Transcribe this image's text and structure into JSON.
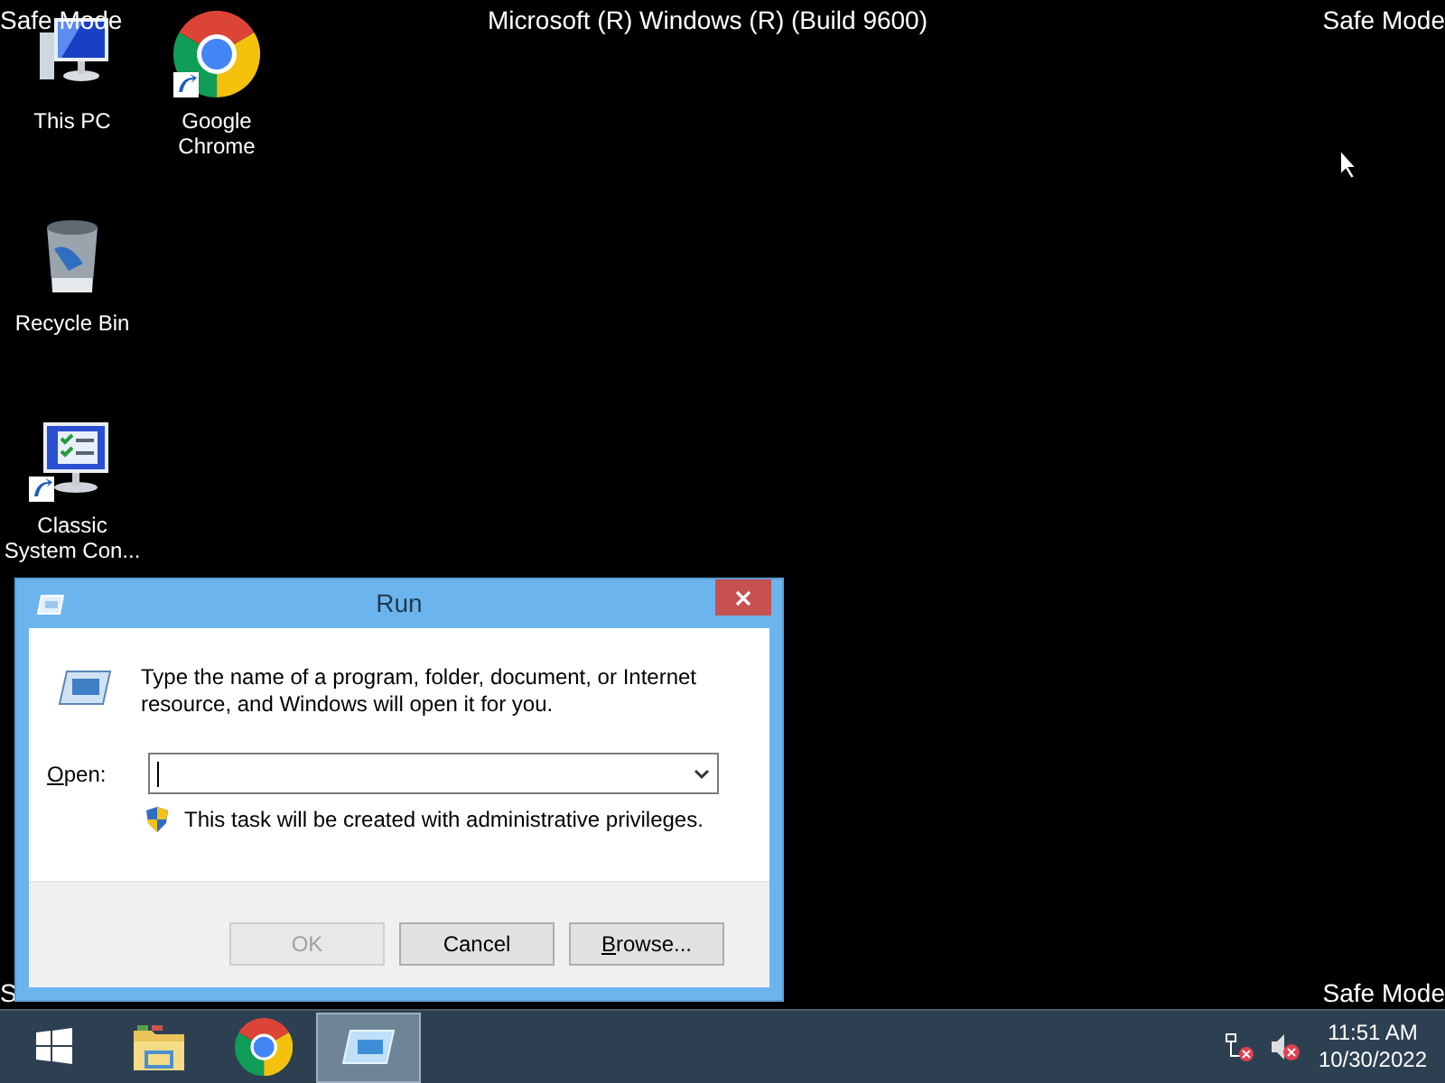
{
  "corner_labels": [
    {
      "text": "Safe Mode"
    },
    {
      "text": "Safe Mode"
    },
    {
      "text": "S"
    },
    {
      "text": "Safe Mode"
    }
  ],
  "build_text": "Microsoft (R) Windows (R) (Build 9600)",
  "desktop_icons": [
    {
      "label": "This PC",
      "kind": "pc",
      "shortcut": false
    },
    {
      "label": "Google Chrome",
      "kind": "chrome",
      "shortcut": true
    },
    {
      "label": "Recycle Bin",
      "kind": "bin",
      "shortcut": false
    },
    {
      "label": "Classic System Con...",
      "kind": "panel",
      "shortcut": true
    }
  ],
  "run_dialog": {
    "title": "Run",
    "description": "Type the name of a program, folder, document, or Internet resource, and Windows will open it for you.",
    "open_label": "Open:",
    "open_label_underlined_first": true,
    "admin_note": "This task will be created with administrative privileges.",
    "buttons": [
      {
        "label": "OK",
        "disabled": true,
        "underlined_first": false
      },
      {
        "label": "Cancel",
        "disabled": false,
        "underlined_first": false
      },
      {
        "label": "Browse...",
        "disabled": false,
        "underlined_first": true
      }
    ]
  },
  "taskbar": {
    "items": [
      {
        "kind": "start",
        "selected": false
      },
      {
        "kind": "explorer",
        "selected": false
      },
      {
        "kind": "chrome",
        "selected": false
      },
      {
        "kind": "run",
        "selected": true
      }
    ],
    "time": "11:51 AM",
    "date": "10/30/2022"
  }
}
